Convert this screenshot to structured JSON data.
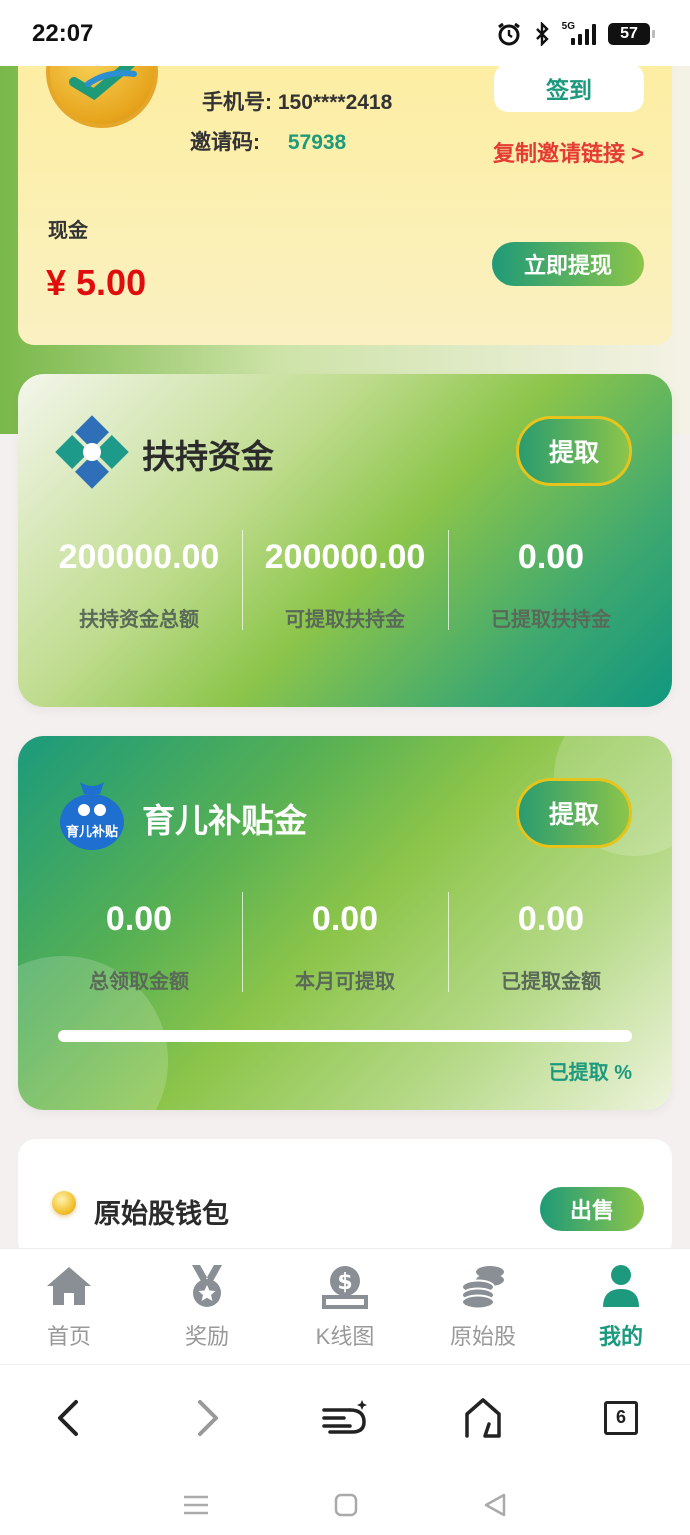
{
  "status_bar": {
    "time": "22:07",
    "network": "5G",
    "battery": "57"
  },
  "profile": {
    "phone_label": "手机号:",
    "phone": "150****2418",
    "invite_label": "邀请码:",
    "invite_code": "57938",
    "signin_label": "签到",
    "copy_link_label": "复制邀请链接 >",
    "cash_label": "现金",
    "cash_amount": "¥ 5.00",
    "withdraw_label": "立即提现"
  },
  "support_fund": {
    "title": "扶持资金",
    "extract_label": "提取",
    "stats": [
      {
        "value": "200000.00",
        "label": "扶持资金总额"
      },
      {
        "value": "200000.00",
        "label": "可提取扶持金"
      },
      {
        "value": "0.00",
        "label": "已提取扶持金"
      }
    ]
  },
  "child_subsidy": {
    "title": "育儿补贴金",
    "icon_text": "育儿补贴",
    "extract_label": "提取",
    "stats": [
      {
        "value": "0.00",
        "label": "总领取金额"
      },
      {
        "value": "0.00",
        "label": "本月可提取"
      },
      {
        "value": "0.00",
        "label": "已提取金额"
      }
    ],
    "progress_fraction": 0,
    "progress_label": "已提取 %"
  },
  "wallet": {
    "title": "原始股钱包",
    "sell_label": "出售"
  },
  "tabs": [
    {
      "label": "首页",
      "icon": "home-icon"
    },
    {
      "label": "奖励",
      "icon": "medal-icon"
    },
    {
      "label": "K线图",
      "icon": "dollar-bag-icon"
    },
    {
      "label": "原始股",
      "icon": "coins-stack-icon"
    },
    {
      "label": "我的",
      "icon": "user-icon",
      "active": true
    }
  ],
  "browser": {
    "tab_count": "6"
  },
  "colors": {
    "accent": "#1d9a7e",
    "brand_green": "#8cc54a",
    "cash_red": "#e00d0d",
    "link_red": "#e43c32"
  }
}
